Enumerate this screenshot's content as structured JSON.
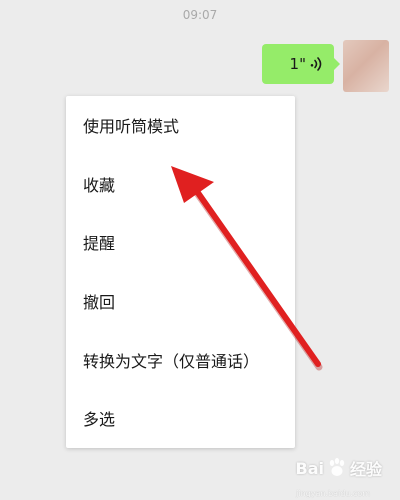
{
  "chat": {
    "timestamp": "09:07",
    "message": {
      "duration": "1\"",
      "icon": "voice-wave-icon"
    },
    "avatar_icon": "avatar"
  },
  "context_menu": {
    "items": [
      {
        "label": "使用听筒模式"
      },
      {
        "label": "收藏"
      },
      {
        "label": "提醒"
      },
      {
        "label": "撤回"
      },
      {
        "label": "转换为文字（仅普通话）"
      },
      {
        "label": "多选"
      }
    ]
  },
  "annotation": {
    "arrow_color": "#e02020"
  },
  "watermark": {
    "left_text": "Bai",
    "right_text": "经验",
    "sub_text": "jingyan.baidu.com"
  },
  "colors": {
    "bubble": "#95ec69",
    "background": "#ececec",
    "menu": "#ffffff"
  }
}
